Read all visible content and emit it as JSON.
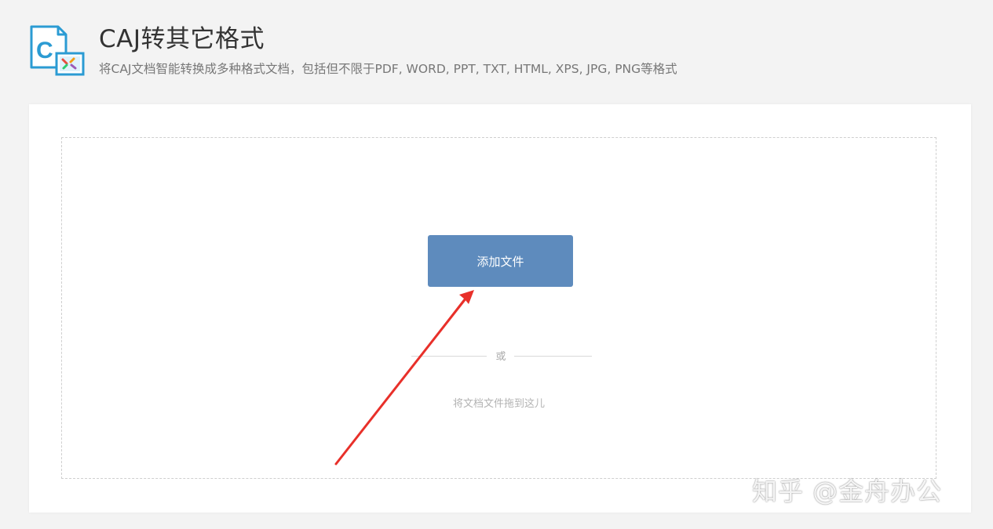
{
  "header": {
    "title": "CAJ转其它格式",
    "subtitle": "将CAJ文档智能转换成多种格式文档，包括但不限于PDF, WORD, PPT, TXT, HTML, XPS, JPG, PNG等格式",
    "logo_icon": "caj-convert-logo-icon"
  },
  "upload": {
    "add_button_label": "添加文件",
    "or_label": "或",
    "drag_hint": "将文档文件拖到这儿"
  },
  "annotation": {
    "arrow_color": "#e8302a"
  },
  "watermark": {
    "text": "知乎 @金舟办公"
  },
  "colors": {
    "button": "#5e8bbd",
    "logo_blue": "#2b9bd3"
  }
}
